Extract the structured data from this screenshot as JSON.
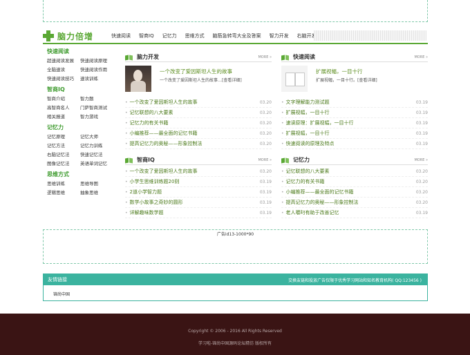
{
  "ad_mid_label": "广告id13-1000*90",
  "brand": {
    "name": "脑力倍增"
  },
  "nav": [
    "快速阅读",
    "智商IQ",
    "记忆力",
    "思维方式",
    "脑筋急转弯大全及答案",
    "智力开发",
    "右脑开发"
  ],
  "sidebar": [
    {
      "title": "快速阅读",
      "items": [
        "超速阅读发展",
        "快速阅读原理",
        "全脑速读",
        "快速阅读作用",
        "快速阅读技巧",
        "速读训练"
      ]
    },
    {
      "title": "智商IQ",
      "items": [
        "智商介绍",
        "智力题",
        "高智商名人",
        "门萨智商测试",
        "相关报道",
        "智力游戏"
      ]
    },
    {
      "title": "记忆力",
      "items": [
        "记忆原理",
        "记忆大师",
        "记忆方法",
        "记忆力训练",
        "右脑记忆法",
        "快速记忆法",
        "图像记忆法",
        "英语单词记忆"
      ]
    },
    {
      "title": "思维方式",
      "items": [
        "思维训练",
        "思维导图",
        "逻辑思维",
        "抽象思维"
      ]
    }
  ],
  "panels": [
    {
      "title": "脑力开发",
      "more": "MORE »",
      "thumb": "photo",
      "feat_title": "一个改变了爱因斯坦人生的故事",
      "feat_desc": "一个改变了爱因斯坦人生的故事…[查看详细]",
      "items": [
        {
          "t": "一个改变了爱因斯坦人生的故事",
          "d": "03.20"
        },
        {
          "t": "记忆联想的八大要素",
          "d": "03.20"
        },
        {
          "t": "记忆力的有关书籍",
          "d": "03.20"
        },
        {
          "t": "小编推荐——最全面的记忆书籍",
          "d": "03.20"
        },
        {
          "t": "提高记忆力的奥秘——形象控制法",
          "d": "03.20"
        }
      ]
    },
    {
      "title": "快速阅读",
      "more": "MORE »",
      "thumb": "books",
      "feat_title": "扩展视幅，一目十行",
      "feat_desc": "扩展视幅，一目十行。[查看详细]",
      "items": [
        {
          "t": "文字理解能力测试题",
          "d": "03.19"
        },
        {
          "t": "扩展视幅，一目十行",
          "d": "03.19"
        },
        {
          "t": "速读原理：扩展视幅，一目十行",
          "d": "03.19"
        },
        {
          "t": "扩展视幅，一目十行",
          "d": "03.19"
        },
        {
          "t": "快速阅读的原理及特点",
          "d": "03.19"
        }
      ]
    },
    {
      "title": "智商IQ",
      "more": "MORE »",
      "items": [
        {
          "t": "一个改变了爱因斯坦人生的故事",
          "d": "03.20"
        },
        {
          "t": "小学生思维训练题20则",
          "d": "03.19"
        },
        {
          "t": "2道小学智力题",
          "d": "03.19"
        },
        {
          "t": "数学小故事之奇妙的圆形",
          "d": "03.19"
        },
        {
          "t": "详解趣味数学题",
          "d": "03.19"
        }
      ]
    },
    {
      "title": "记忆力",
      "more": "MORE »",
      "items": [
        {
          "t": "记忆联想的八大要素",
          "d": "03.20"
        },
        {
          "t": "记忆力的有关书籍",
          "d": "03.20"
        },
        {
          "t": "小编推荐——最全面的记忆书籍",
          "d": "03.20"
        },
        {
          "t": "提高记忆力的奥秘——形象控制法",
          "d": "03.20"
        },
        {
          "t": "老人嚼叼有助于改善记忆",
          "d": "03.19"
        }
      ]
    }
  ],
  "links": {
    "title": "友情链接",
    "note": "交换友链和投放广告仅限于优秀学习网站和知名教育机构( QQ:123456 )",
    "items": [
      "锦尚中国"
    ]
  },
  "footer": {
    "copyright": "Copyright © 2006 - 2016 All Rights Reserved",
    "line2": "学习啦-锦尚中国源码论坛精仿 版权所有"
  }
}
